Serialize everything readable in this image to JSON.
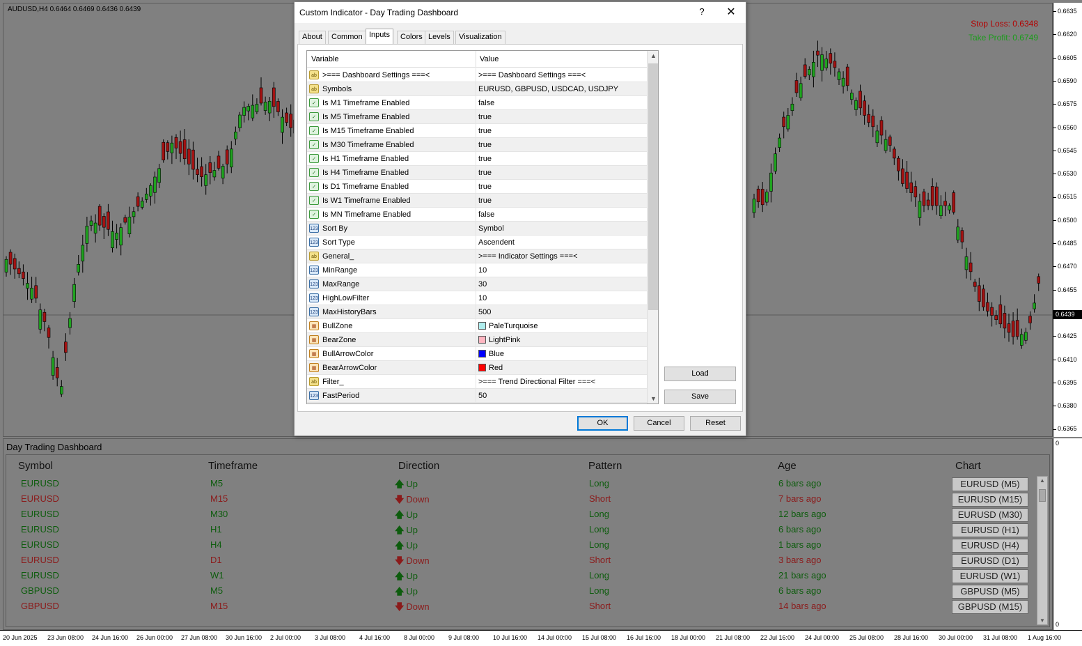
{
  "chart": {
    "symbol_info": "AUDUSD,H4  0.6464 0.6469 0.6436 0.6439",
    "stop_loss": "Stop Loss: 0.6348",
    "take_profit": "Take Profit: 0.6749",
    "current_price": "0.6439",
    "price_ticks": [
      "0.6635",
      "0.6620",
      "0.6605",
      "0.6590",
      "0.6575",
      "0.6560",
      "0.6545",
      "0.6530",
      "0.6515",
      "0.6500",
      "0.6485",
      "0.6470",
      "0.6455",
      "0.6425",
      "0.6410",
      "0.6395",
      "0.6380",
      "0.6365"
    ],
    "indicator_axis": {
      "top": "0",
      "bottom": "0"
    },
    "time_ticks": [
      "20 Jun 2025",
      "23 Jun 08:00",
      "24 Jun 16:00",
      "26 Jun 00:00",
      "27 Jun 08:00",
      "30 Jun 16:00",
      "2 Jul 00:00",
      "3 Jul 08:00",
      "4 Jul 16:00",
      "8 Jul 00:00",
      "9 Jul 08:00",
      "10 Jul 16:00",
      "14 Jul 00:00",
      "15 Jul 08:00",
      "16 Jul 16:00",
      "18 Jul 00:00",
      "21 Jul 08:00",
      "22 Jul 16:00",
      "24 Jul 00:00",
      "25 Jul 08:00",
      "28 Jul 16:00",
      "30 Jul 00:00",
      "31 Jul 08:00",
      "1 Aug 16:00"
    ],
    "colors": {
      "bull": "#1fa31f",
      "bear": "#a31212",
      "background": "#808080"
    }
  },
  "dashboard": {
    "title": "Day Trading Dashboard",
    "headers": {
      "symbol": "Symbol",
      "timeframe": "Timeframe",
      "direction": "Direction",
      "pattern": "Pattern",
      "age": "Age",
      "chart": "Chart"
    },
    "rows": [
      {
        "symbol": "EURUSD",
        "timeframe": "M5",
        "direction": "Up",
        "pattern": "Long",
        "age": "6 bars ago",
        "chart": "EURUSD (M5)",
        "trend": "up"
      },
      {
        "symbol": "EURUSD",
        "timeframe": "M15",
        "direction": "Down",
        "pattern": "Short",
        "age": "7 bars ago",
        "chart": "EURUSD (M15)",
        "trend": "down"
      },
      {
        "symbol": "EURUSD",
        "timeframe": "M30",
        "direction": "Up",
        "pattern": "Long",
        "age": "12 bars ago",
        "chart": "EURUSD (M30)",
        "trend": "up"
      },
      {
        "symbol": "EURUSD",
        "timeframe": "H1",
        "direction": "Up",
        "pattern": "Long",
        "age": "6 bars ago",
        "chart": "EURUSD (H1)",
        "trend": "up"
      },
      {
        "symbol": "EURUSD",
        "timeframe": "H4",
        "direction": "Up",
        "pattern": "Long",
        "age": "1 bars ago",
        "chart": "EURUSD (H4)",
        "trend": "up"
      },
      {
        "symbol": "EURUSD",
        "timeframe": "D1",
        "direction": "Down",
        "pattern": "Short",
        "age": "3 bars ago",
        "chart": "EURUSD (D1)",
        "trend": "down"
      },
      {
        "symbol": "EURUSD",
        "timeframe": "W1",
        "direction": "Up",
        "pattern": "Long",
        "age": "21 bars ago",
        "chart": "EURUSD (W1)",
        "trend": "up"
      },
      {
        "symbol": "GBPUSD",
        "timeframe": "M5",
        "direction": "Up",
        "pattern": "Long",
        "age": "6 bars ago",
        "chart": "GBPUSD (M5)",
        "trend": "up"
      },
      {
        "symbol": "GBPUSD",
        "timeframe": "M15",
        "direction": "Down",
        "pattern": "Short",
        "age": "14 bars ago",
        "chart": "GBPUSD (M15)",
        "trend": "down"
      }
    ]
  },
  "dialog": {
    "title": "Custom Indicator - Day Trading Dashboard",
    "help": "?",
    "close": "✕",
    "tabs": [
      "About",
      "Common",
      "Inputs",
      "Colors",
      "Levels",
      "Visualization"
    ],
    "active_tab": "Inputs",
    "grid_headers": {
      "variable": "Variable",
      "value": "Value"
    },
    "inputs": [
      {
        "icon": "ab",
        "kind": "str",
        "name": ">=== Dashboard Settings ===<",
        "value": ">=== Dashboard Settings ===<"
      },
      {
        "icon": "ab",
        "kind": "str",
        "name": "Symbols",
        "value": "EURUSD, GBPUSD, USDCAD, USDJPY"
      },
      {
        "icon": "✓",
        "kind": "bool",
        "name": "Is M1 Timeframe Enabled",
        "value": "false"
      },
      {
        "icon": "✓",
        "kind": "bool",
        "name": "Is M5 Timeframe Enabled",
        "value": "true"
      },
      {
        "icon": "✓",
        "kind": "bool",
        "name": "Is M15 Timeframe Enabled",
        "value": "true"
      },
      {
        "icon": "✓",
        "kind": "bool",
        "name": "Is M30 Timeframe Enabled",
        "value": "true"
      },
      {
        "icon": "✓",
        "kind": "bool",
        "name": "Is H1 Timeframe Enabled",
        "value": "true"
      },
      {
        "icon": "✓",
        "kind": "bool",
        "name": "Is H4 Timeframe Enabled",
        "value": "true"
      },
      {
        "icon": "✓",
        "kind": "bool",
        "name": "Is D1 Timeframe Enabled",
        "value": "true"
      },
      {
        "icon": "✓",
        "kind": "bool",
        "name": "Is W1 Timeframe Enabled",
        "value": "true"
      },
      {
        "icon": "✓",
        "kind": "bool",
        "name": "Is MN Timeframe Enabled",
        "value": "false"
      },
      {
        "icon": "123",
        "kind": "num",
        "name": "Sort By",
        "value": "Symbol"
      },
      {
        "icon": "123",
        "kind": "num",
        "name": "Sort Type",
        "value": "Ascendent"
      },
      {
        "icon": "ab",
        "kind": "str",
        "name": "General_",
        "value": ">=== Indicator Settings ===<"
      },
      {
        "icon": "123",
        "kind": "num",
        "name": "MinRange",
        "value": "10"
      },
      {
        "icon": "123",
        "kind": "num",
        "name": "MaxRange",
        "value": "30"
      },
      {
        "icon": "123",
        "kind": "num",
        "name": "HighLowFilter",
        "value": "10"
      },
      {
        "icon": "123",
        "kind": "num",
        "name": "MaxHistoryBars",
        "value": "500"
      },
      {
        "icon": "▦",
        "kind": "col",
        "name": "BullZone",
        "value": "PaleTurquoise",
        "swatch": "#afeeee"
      },
      {
        "icon": "▦",
        "kind": "col",
        "name": "BearZone",
        "value": "LightPink",
        "swatch": "#ffb6c1"
      },
      {
        "icon": "▦",
        "kind": "col",
        "name": "BullArrowColor",
        "value": "Blue",
        "swatch": "#0000ff"
      },
      {
        "icon": "▦",
        "kind": "col",
        "name": "BearArrowColor",
        "value": "Red",
        "swatch": "#ff0000"
      },
      {
        "icon": "ab",
        "kind": "str",
        "name": "Filter_",
        "value": ">=== Trend Directional Filter ===<"
      },
      {
        "icon": "123",
        "kind": "num",
        "name": "FastPeriod",
        "value": "50"
      }
    ],
    "buttons": {
      "load": "Load",
      "save": "Save",
      "ok": "OK",
      "cancel": "Cancel",
      "reset": "Reset"
    }
  }
}
